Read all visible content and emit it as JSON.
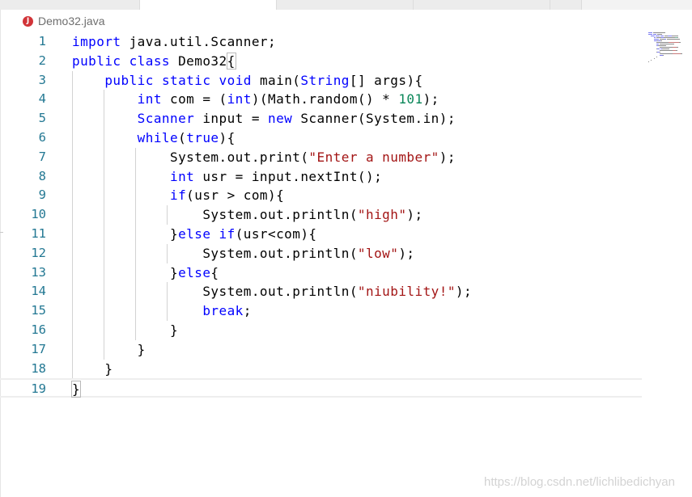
{
  "tab": {
    "title": "Demo32.java",
    "icon": "J",
    "icon_color": "#d13438"
  },
  "lines": [
    {
      "n": "1",
      "tokens": [
        {
          "t": "import",
          "c": "kw"
        },
        {
          "t": " java.util.Scanner;"
        }
      ]
    },
    {
      "n": "2",
      "tokens": [
        {
          "t": "public",
          "c": "kw"
        },
        {
          "t": " "
        },
        {
          "t": "class",
          "c": "kw"
        },
        {
          "t": " Demo32"
        },
        {
          "t": "{",
          "c": "bh"
        }
      ]
    },
    {
      "n": "3",
      "tokens": [
        {
          "t": "    "
        },
        {
          "t": "public",
          "c": "kw"
        },
        {
          "t": " "
        },
        {
          "t": "static",
          "c": "kw"
        },
        {
          "t": " "
        },
        {
          "t": "void",
          "c": "kw"
        },
        {
          "t": " main("
        },
        {
          "t": "String",
          "c": "kw"
        },
        {
          "t": "[] args){"
        }
      ]
    },
    {
      "n": "4",
      "tokens": [
        {
          "t": "        "
        },
        {
          "t": "int",
          "c": "kw"
        },
        {
          "t": " com = ("
        },
        {
          "t": "int",
          "c": "kw"
        },
        {
          "t": ")(Math.random() * "
        },
        {
          "t": "101",
          "c": "num"
        },
        {
          "t": ");"
        }
      ]
    },
    {
      "n": "5",
      "tokens": [
        {
          "t": "        "
        },
        {
          "t": "Scanner",
          "c": "kw"
        },
        {
          "t": " input = "
        },
        {
          "t": "new",
          "c": "kw"
        },
        {
          "t": " Scanner(System.in);"
        }
      ]
    },
    {
      "n": "6",
      "tokens": [
        {
          "t": "        "
        },
        {
          "t": "while",
          "c": "kw"
        },
        {
          "t": "("
        },
        {
          "t": "true",
          "c": "kw"
        },
        {
          "t": "){"
        }
      ]
    },
    {
      "n": "7",
      "tokens": [
        {
          "t": "            System.out.print("
        },
        {
          "t": "\"Enter a number\"",
          "c": "str"
        },
        {
          "t": ");"
        }
      ]
    },
    {
      "n": "8",
      "tokens": [
        {
          "t": "            "
        },
        {
          "t": "int",
          "c": "kw"
        },
        {
          "t": " usr = input.nextInt();"
        }
      ]
    },
    {
      "n": "9",
      "tokens": [
        {
          "t": "            "
        },
        {
          "t": "if",
          "c": "kw"
        },
        {
          "t": "(usr > com){"
        }
      ]
    },
    {
      "n": "10",
      "tokens": [
        {
          "t": "                System.out.println("
        },
        {
          "t": "\"high\"",
          "c": "str"
        },
        {
          "t": ");"
        }
      ]
    },
    {
      "n": "11",
      "tokens": [
        {
          "t": "            }"
        },
        {
          "t": "else",
          "c": "kw"
        },
        {
          "t": " "
        },
        {
          "t": "if",
          "c": "kw"
        },
        {
          "t": "(usr<com){"
        }
      ]
    },
    {
      "n": "12",
      "tokens": [
        {
          "t": "                System.out.println("
        },
        {
          "t": "\"low\"",
          "c": "str"
        },
        {
          "t": ");"
        }
      ]
    },
    {
      "n": "13",
      "tokens": [
        {
          "t": "            }"
        },
        {
          "t": "else",
          "c": "kw"
        },
        {
          "t": "{"
        }
      ]
    },
    {
      "n": "14",
      "tokens": [
        {
          "t": "                System.out.println("
        },
        {
          "t": "\"niubility!\"",
          "c": "str"
        },
        {
          "t": ");"
        }
      ]
    },
    {
      "n": "15",
      "tokens": [
        {
          "t": "                "
        },
        {
          "t": "break",
          "c": "kw"
        },
        {
          "t": ";"
        }
      ]
    },
    {
      "n": "16",
      "tokens": [
        {
          "t": "            }"
        }
      ]
    },
    {
      "n": "17",
      "tokens": [
        {
          "t": "        }"
        }
      ]
    },
    {
      "n": "18",
      "tokens": [
        {
          "t": "    }"
        }
      ]
    },
    {
      "n": "19",
      "tokens": [
        {
          "t": "}",
          "c": "bh"
        }
      ]
    }
  ],
  "current_line": "19",
  "colors": {
    "keyword": "#0000ff",
    "string": "#a31515",
    "number": "#098658",
    "line_number": "#237893",
    "text": "#000000"
  },
  "watermark": "https://blog.csdn.net/lichlibedichyan"
}
